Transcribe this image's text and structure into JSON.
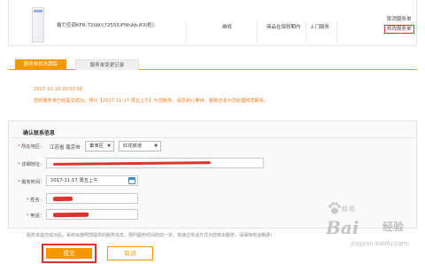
{
  "order": {
    "product_name": "格力空调KFR-72LW/(72555)FNhAb-A3(柜)",
    "service_type": "维修",
    "warranty": "商品在保修期内",
    "service_method": "上门服务",
    "ops": {
      "cancel": "取消服务单",
      "modify": "修改服务单"
    }
  },
  "tabs": [
    {
      "label": "服务单状态跟踪",
      "active": true
    },
    {
      "label": "服务单变更记录",
      "active": false
    }
  ],
  "status": {
    "time": "2017-11-10 20:52:56",
    "message": "您的服务单已经提交成功，预计【2017-11-17 周五上午】为您服务，请您耐心等待，客服还会为您处理和您联系。"
  },
  "confirm": {
    "title": "确认联系信息",
    "region_label": "所在地区：",
    "region_text": "江苏省 南京市",
    "district": "秦淮区",
    "street": "红花街道",
    "address_label": "详细地址：",
    "service_time_label": "服务时间：",
    "service_time_value": "2017-11-17 周五上午",
    "name_label": "姓名",
    "phone_label": "电话："
  },
  "note": "服务单提交成功后，系统会按照您提供的服务信息，预约服务时间的前一天，将通过电话方式为您核实服务，请保持电话畅通！",
  "buttons": {
    "submit": "提交",
    "cancel": "取消"
  },
  "watermark": {
    "line1": "经验",
    "brand": "Bai",
    "brand2": "经验",
    "url": "jingyan.baidu.com"
  },
  "colors": {
    "accent": "#f39800",
    "highlight": "#e0342b",
    "message": "#ee7c18",
    "calendar": "#3b8ad9"
  },
  "icons": [
    "calendar-icon",
    "chevron-down-icon",
    "baidu-paw-icon"
  ]
}
